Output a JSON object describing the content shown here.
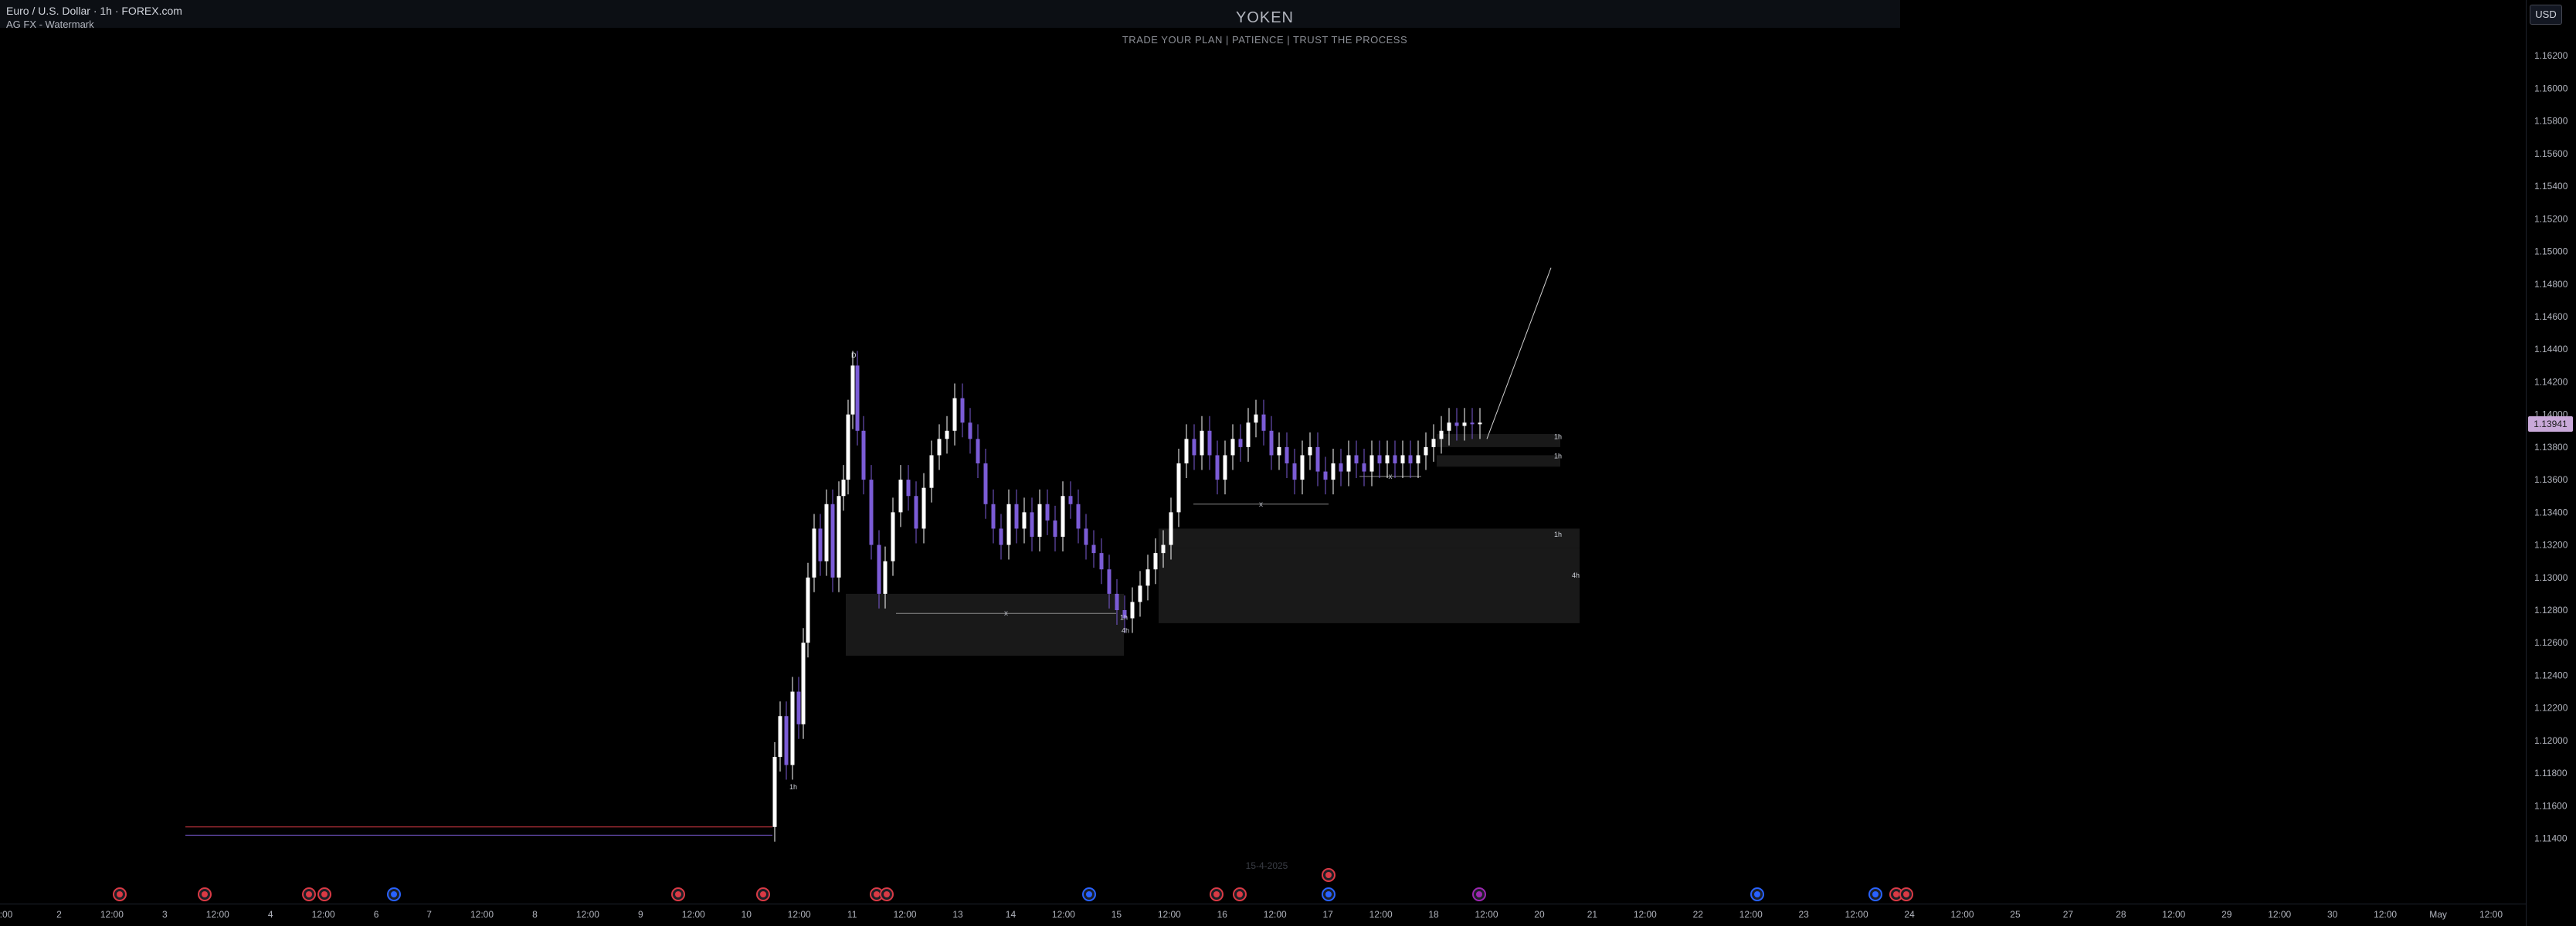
{
  "header": {
    "symbol_title": "Euro / U.S. Dollar · 1h · FOREX.com",
    "indicator": "AG FX - Watermark",
    "watermark_title": "YOKEN",
    "watermark_subtitle": "TRADE YOUR PLAN | PATIENCE | TRUST THE PROCESS",
    "currency": "USD",
    "last_price": "1.13941"
  },
  "colors": {
    "background": "#000000",
    "bull_candle": "#ffffff",
    "bear_candle": "#7b5cd6",
    "zone_fill": "#1c1c1c",
    "grid_text": "#b2b5be",
    "price_tag": "#c9a9d9",
    "event_red": "#d93a45",
    "event_blue": "#2962ff"
  },
  "chart_data": {
    "type": "candlestick",
    "ylim": [
      1.11,
      1.164
    ],
    "y_ticks": [
      "1.16200",
      "1.16000",
      "1.15800",
      "1.15600",
      "1.15400",
      "1.15200",
      "1.15000",
      "1.14800",
      "1.14600",
      "1.14400",
      "1.14200",
      "1.14000",
      "1.13800",
      "1.13600",
      "1.13400",
      "1.13200",
      "1.13000",
      "1.12800",
      "1.12600",
      "1.12400",
      "1.12200",
      "1.12000",
      "1.11800",
      "1.11600",
      "1.11400"
    ],
    "x_ticks": [
      ":00",
      "2",
      "12:00",
      "3",
      "12:00",
      "4",
      "12:00",
      "6",
      "7",
      "12:00",
      "8",
      "12:00",
      "9",
      "12:00",
      "10",
      "12:00",
      "11",
      "12:00",
      "13",
      "14",
      "12:00",
      "15",
      "12:00",
      "16",
      "12:00",
      "17",
      "12:00",
      "18",
      "12:00",
      "20",
      "21",
      "12:00",
      "22",
      "12:00",
      "23",
      "12:00",
      "24",
      "12:00",
      "25",
      "27",
      "28",
      "12:00",
      "29",
      "12:00",
      "30",
      "12:00",
      "May",
      "12:00"
    ],
    "series_anchors": [
      {
        "x": 1000,
        "y": 1.1147
      },
      {
        "x": 1003,
        "y": 1.119
      },
      {
        "x": 1010,
        "y": 1.1215
      },
      {
        "x": 1018,
        "y": 1.1185
      },
      {
        "x": 1026,
        "y": 1.123
      },
      {
        "x": 1034,
        "y": 1.121
      },
      {
        "x": 1040,
        "y": 1.126
      },
      {
        "x": 1046,
        "y": 1.13
      },
      {
        "x": 1054,
        "y": 1.133
      },
      {
        "x": 1062,
        "y": 1.131
      },
      {
        "x": 1070,
        "y": 1.1345
      },
      {
        "x": 1078,
        "y": 1.13
      },
      {
        "x": 1086,
        "y": 1.135
      },
      {
        "x": 1092,
        "y": 1.136
      },
      {
        "x": 1098,
        "y": 1.14
      },
      {
        "x": 1104,
        "y": 1.143
      },
      {
        "x": 1110,
        "y": 1.139
      },
      {
        "x": 1118,
        "y": 1.136
      },
      {
        "x": 1128,
        "y": 1.132
      },
      {
        "x": 1138,
        "y": 1.129
      },
      {
        "x": 1146,
        "y": 1.131
      },
      {
        "x": 1156,
        "y": 1.134
      },
      {
        "x": 1166,
        "y": 1.136
      },
      {
        "x": 1176,
        "y": 1.135
      },
      {
        "x": 1186,
        "y": 1.133
      },
      {
        "x": 1196,
        "y": 1.1355
      },
      {
        "x": 1206,
        "y": 1.1375
      },
      {
        "x": 1216,
        "y": 1.1385
      },
      {
        "x": 1226,
        "y": 1.139
      },
      {
        "x": 1236,
        "y": 1.141
      },
      {
        "x": 1246,
        "y": 1.1395
      },
      {
        "x": 1256,
        "y": 1.1385
      },
      {
        "x": 1266,
        "y": 1.137
      },
      {
        "x": 1276,
        "y": 1.1345
      },
      {
        "x": 1286,
        "y": 1.133
      },
      {
        "x": 1296,
        "y": 1.132
      },
      {
        "x": 1306,
        "y": 1.1345
      },
      {
        "x": 1316,
        "y": 1.133
      },
      {
        "x": 1326,
        "y": 1.134
      },
      {
        "x": 1336,
        "y": 1.1325
      },
      {
        "x": 1346,
        "y": 1.1345
      },
      {
        "x": 1356,
        "y": 1.1335
      },
      {
        "x": 1366,
        "y": 1.1325
      },
      {
        "x": 1376,
        "y": 1.135
      },
      {
        "x": 1386,
        "y": 1.1345
      },
      {
        "x": 1396,
        "y": 1.133
      },
      {
        "x": 1406,
        "y": 1.132
      },
      {
        "x": 1416,
        "y": 1.1315
      },
      {
        "x": 1426,
        "y": 1.1305
      },
      {
        "x": 1436,
        "y": 1.129
      },
      {
        "x": 1446,
        "y": 1.128
      },
      {
        "x": 1456,
        "y": 1.1275
      },
      {
        "x": 1466,
        "y": 1.1285
      },
      {
        "x": 1476,
        "y": 1.1295
      },
      {
        "x": 1486,
        "y": 1.1305
      },
      {
        "x": 1496,
        "y": 1.1315
      },
      {
        "x": 1506,
        "y": 1.132
      },
      {
        "x": 1516,
        "y": 1.134
      },
      {
        "x": 1526,
        "y": 1.137
      },
      {
        "x": 1536,
        "y": 1.1385
      },
      {
        "x": 1546,
        "y": 1.1375
      },
      {
        "x": 1556,
        "y": 1.139
      },
      {
        "x": 1566,
        "y": 1.1375
      },
      {
        "x": 1576,
        "y": 1.136
      },
      {
        "x": 1586,
        "y": 1.1375
      },
      {
        "x": 1596,
        "y": 1.1385
      },
      {
        "x": 1606,
        "y": 1.138
      },
      {
        "x": 1616,
        "y": 1.1395
      },
      {
        "x": 1626,
        "y": 1.14
      },
      {
        "x": 1636,
        "y": 1.139
      },
      {
        "x": 1646,
        "y": 1.1375
      },
      {
        "x": 1656,
        "y": 1.138
      },
      {
        "x": 1666,
        "y": 1.137
      },
      {
        "x": 1676,
        "y": 1.136
      },
      {
        "x": 1686,
        "y": 1.1375
      },
      {
        "x": 1696,
        "y": 1.138
      },
      {
        "x": 1706,
        "y": 1.1365
      },
      {
        "x": 1716,
        "y": 1.136
      },
      {
        "x": 1726,
        "y": 1.137
      },
      {
        "x": 1736,
        "y": 1.1365
      },
      {
        "x": 1746,
        "y": 1.1375
      },
      {
        "x": 1756,
        "y": 1.137
      },
      {
        "x": 1766,
        "y": 1.1365
      },
      {
        "x": 1776,
        "y": 1.1375
      },
      {
        "x": 1786,
        "y": 1.137
      },
      {
        "x": 1796,
        "y": 1.1375
      },
      {
        "x": 1806,
        "y": 1.137
      },
      {
        "x": 1816,
        "y": 1.1375
      },
      {
        "x": 1826,
        "y": 1.137
      },
      {
        "x": 1836,
        "y": 1.1375
      },
      {
        "x": 1846,
        "y": 1.138
      },
      {
        "x": 1856,
        "y": 1.1385
      },
      {
        "x": 1866,
        "y": 1.139
      },
      {
        "x": 1876,
        "y": 1.1395
      },
      {
        "x": 1886,
        "y": 1.1393
      },
      {
        "x": 1896,
        "y": 1.1395
      },
      {
        "x": 1906,
        "y": 1.1394
      },
      {
        "x": 1916,
        "y": 1.1395
      }
    ],
    "zones": [
      {
        "label": "1h",
        "x0": 1860,
        "x1": 2020,
        "y0": 1.138,
        "y1": 1.1388
      },
      {
        "label": "1h",
        "x0": 1860,
        "x1": 2020,
        "y0": 1.1368,
        "y1": 1.1375
      },
      {
        "label": "1h",
        "x0": 1500,
        "x1": 2045,
        "y0": 1.1318,
        "y1": 1.133
      },
      {
        "label": "4h",
        "x0": 1500,
        "x1": 2045,
        "y0": 1.1272,
        "y1": 1.1318
      },
      {
        "label": "4h",
        "x0": 1095,
        "x1": 1455,
        "y0": 1.1252,
        "y1": 1.129
      }
    ],
    "ranges": [
      {
        "label": "x",
        "x0": 1160,
        "x1": 1445,
        "y": 1.1278
      },
      {
        "label": "x",
        "x0": 1545,
        "x1": 1720,
        "y": 1.1345
      },
      {
        "label": "x",
        "x0": 1760,
        "x1": 1840,
        "y": 1.1362
      }
    ],
    "projection": [
      {
        "x": 1925,
        "y": 1.1385
      },
      {
        "x": 2008,
        "y": 1.149
      }
    ],
    "text_labels": [
      {
        "text": "D",
        "x": 1102,
        "y": 1.1435
      },
      {
        "text": "1h",
        "x": 1022,
        "y": 1.117
      },
      {
        "text": "1h",
        "x": 1450,
        "y": 1.1274
      },
      {
        "text": "4h",
        "x": 1452,
        "y": 1.1266
      },
      {
        "text": "1h",
        "x": 2012,
        "y": 1.1385
      },
      {
        "text": "1h",
        "x": 2012,
        "y": 1.1373
      },
      {
        "text": "1h",
        "x": 2012,
        "y": 1.1325
      },
      {
        "text": "4h",
        "x": 2035,
        "y": 1.13
      }
    ],
    "events": [
      {
        "x": 155,
        "kind": "flag-red"
      },
      {
        "x": 265,
        "kind": "flag-red"
      },
      {
        "x": 400,
        "kind": "flag-red"
      },
      {
        "x": 420,
        "kind": "flag-red"
      },
      {
        "x": 510,
        "kind": "flag-blue"
      },
      {
        "x": 878,
        "kind": "flag-red"
      },
      {
        "x": 988,
        "kind": "flag-red"
      },
      {
        "x": 1135,
        "kind": "flag-red"
      },
      {
        "x": 1148,
        "kind": "flag-red"
      },
      {
        "x": 1410,
        "kind": "flag-blue"
      },
      {
        "x": 1575,
        "kind": "flag-red"
      },
      {
        "x": 1605,
        "kind": "flag-red"
      },
      {
        "x": 1720,
        "kind": "flag-blue"
      },
      {
        "x": 1720,
        "kind": "flag-red",
        "upper": true
      },
      {
        "x": 1915,
        "kind": "flag-purple"
      },
      {
        "x": 2275,
        "kind": "flag-blue"
      },
      {
        "x": 2428,
        "kind": "flag-blue"
      },
      {
        "x": 2455,
        "kind": "flag-red"
      },
      {
        "x": 2468,
        "kind": "flag-red"
      }
    ],
    "date_overlay": "15-4-2025"
  }
}
